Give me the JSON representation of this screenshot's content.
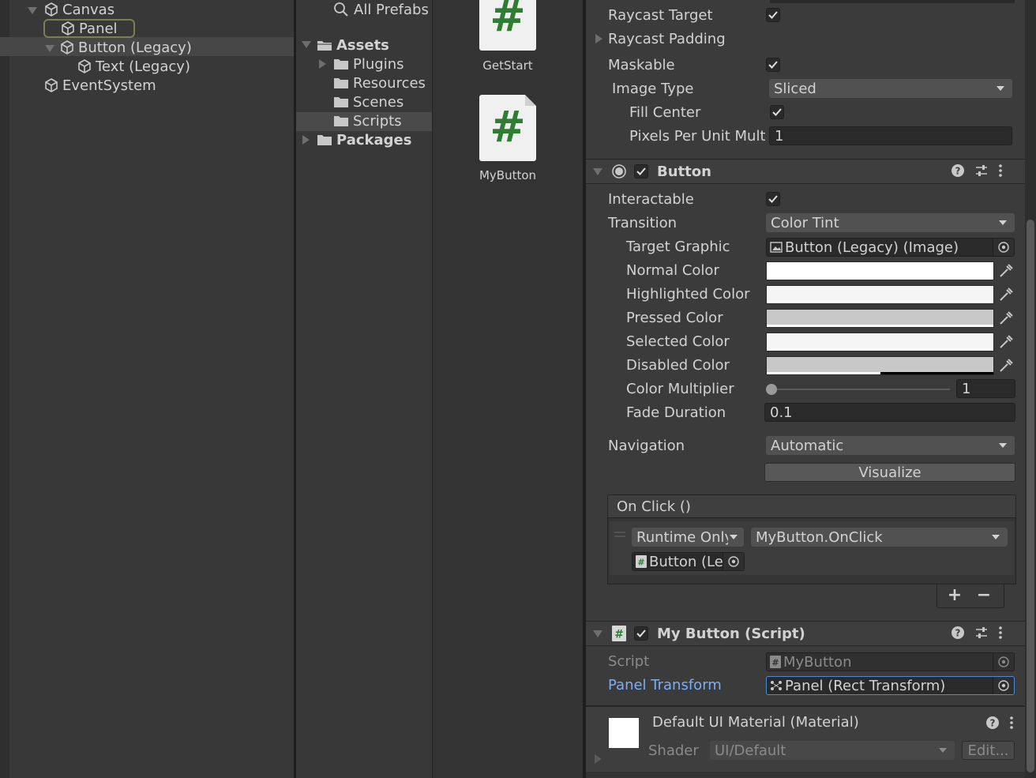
{
  "hierarchy": {
    "canvas": "Canvas",
    "panel": "Panel",
    "button_legacy": "Button (Legacy)",
    "text_legacy": "Text (Legacy)",
    "event_system": "EventSystem"
  },
  "project": {
    "search_label": "All Prefabs",
    "assets": "Assets",
    "plugins": "Plugins",
    "resources": "Resources",
    "scenes": "Scenes",
    "scripts": "Scripts",
    "packages": "Packages"
  },
  "asset_grid": {
    "items": [
      {
        "label": "GetStart",
        "icon": "csharp-script-icon"
      },
      {
        "label": "MyButton",
        "icon": "csharp-script-icon"
      }
    ],
    "glyph": "#"
  },
  "image_component": {
    "raycast_target": "Raycast Target",
    "raycast_padding": "Raycast Padding",
    "maskable": "Maskable",
    "image_type_label": "Image Type",
    "image_type_value": "Sliced",
    "fill_center": "Fill Center",
    "pixels_per_unit_label": "Pixels Per Unit Multi",
    "pixels_per_unit_value": "1"
  },
  "button_component": {
    "title": "Button",
    "interactable": "Interactable",
    "transition_label": "Transition",
    "transition_value": "Color Tint",
    "target_graphic_label": "Target Graphic",
    "target_graphic_value": "Button (Legacy) (Image)",
    "normal_color_label": "Normal Color",
    "highlighted_color_label": "Highlighted Color",
    "pressed_color_label": "Pressed Color",
    "selected_color_label": "Selected Color",
    "disabled_color_label": "Disabled Color",
    "color_multiplier_label": "Color Multiplier",
    "color_multiplier_value": "1",
    "color_multiplier_fraction": 0,
    "fade_duration_label": "Fade Duration",
    "fade_duration_value": "0.1",
    "navigation_label": "Navigation",
    "navigation_value": "Automatic",
    "visualize": "Visualize",
    "on_click_title": "On Click ()",
    "runtime_value": "Runtime Only",
    "function_value": "MyButton.OnClick",
    "object_value": "Button (Le",
    "add": "+",
    "remove": "−",
    "colors": {
      "normal": "#ffffff",
      "highlighted": "#f5f5f5",
      "pressed": "#c8c8c8",
      "selected": "#f5f5f5",
      "disabled": "#c8c8c8"
    }
  },
  "script_component": {
    "title": "My Button (Script)",
    "script_label": "Script",
    "script_value": "MyButton",
    "panel_transform_label": "Panel Transform",
    "panel_transform_value": "Panel (Rect Transform)"
  },
  "material": {
    "title": "Default UI Material (Material)",
    "shader_label": "Shader",
    "shader_value": "UI/Default",
    "edit": "Edit..."
  },
  "colors": {
    "accent_link": "#7aaef5",
    "selection_outline": "#7d7d54",
    "script_hash": "#2e7d32"
  }
}
